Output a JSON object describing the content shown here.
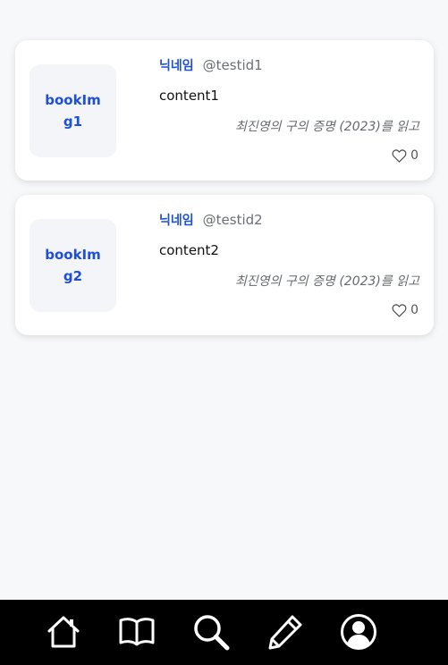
{
  "posts": [
    {
      "thumb_label": "bookImg1",
      "nickname": "닉네임",
      "user_id": "@testid1",
      "content": "content1",
      "book_ref": "최진영의 구의 증명 (2023)를 읽고",
      "likes": "0"
    },
    {
      "thumb_label": "bookImg2",
      "nickname": "닉네임",
      "user_id": "@testid2",
      "content": "content2",
      "book_ref": "최진영의 구의 증명 (2023)를 읽고",
      "likes": "0"
    }
  ],
  "tabbar": {
    "items": [
      {
        "icon": "home-icon"
      },
      {
        "icon": "book-icon"
      },
      {
        "icon": "search-icon"
      },
      {
        "icon": "pencil-icon"
      },
      {
        "icon": "profile-icon"
      }
    ]
  },
  "colors": {
    "accent": "#1d4fd8",
    "background": "#f7f8fa",
    "tabbar": "#000000"
  }
}
